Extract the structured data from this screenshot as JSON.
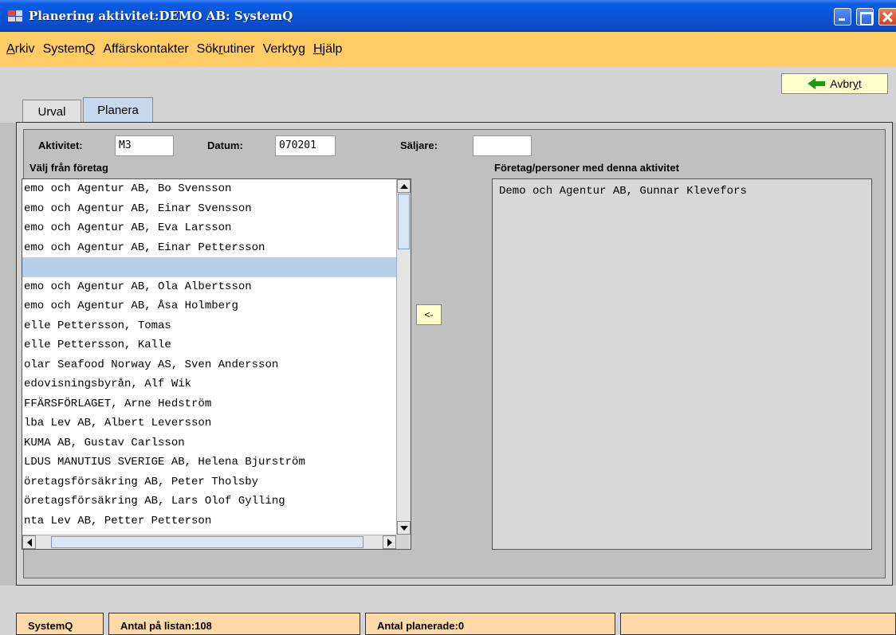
{
  "window": {
    "title": "Planering aktivitet:DEMO AB: SystemQ"
  },
  "menu": [
    {
      "pre": "",
      "ul": "A",
      "post": "rkiv"
    },
    {
      "pre": "System",
      "ul": "Q",
      "post": ""
    },
    {
      "pre": "Affärskontakter",
      "ul": "",
      "post": ""
    },
    {
      "pre": "Sök",
      "ul": "r",
      "post": "utiner"
    },
    {
      "pre": "Verktyg",
      "ul": "",
      "post": ""
    },
    {
      "pre": "",
      "ul": "H",
      "post": "jälp"
    }
  ],
  "toolbar": {
    "cancel_label_pre": "Avbr",
    "cancel_label_ul": "y",
    "cancel_label_post": "t"
  },
  "tabs": [
    {
      "label": "Urval",
      "active": false
    },
    {
      "label": "Planera",
      "active": true
    }
  ],
  "form": {
    "activity_label": "Aktivitet:",
    "activity_value": "M3",
    "date_label": "Datum:",
    "date_value": "070201",
    "seller_label": "Säljare:",
    "seller_value": ""
  },
  "left_list": {
    "title": "Välj från företag",
    "selected_index": 4,
    "items": [
      "emo och Agentur AB,  Bo Svensson",
      "emo och Agentur AB,  Einar Svensson",
      "emo och Agentur AB,  Eva Larsson",
      "emo och Agentur AB,  Einar Pettersson",
      "",
      "emo och Agentur AB,  Ola Albertsson",
      "emo och Agentur AB,  Åsa Holmberg",
      "elle Pettersson,  Tomas",
      "elle Pettersson,  Kalle",
      "olar Seafood Norway AS,  Sven Andersson",
      "edovisningsbyrån,  Alf Wik",
      "FFÄRSFÖRLAGET,  Arne Hedström",
      "lba Lev AB,  Albert Leversson",
      "KUMA AB,  Gustav Carlsson",
      "LDUS MANUTIUS SVERIGE AB,  Helena Bjurström",
      "öretagsförsäkring AB,  Peter Tholsby",
      "öretagsförsäkring AB,  Lars Olof Gylling",
      "nta Lev AB,  Petter Petterson"
    ]
  },
  "move_button_label": "<-",
  "right_list": {
    "title": "Företag/personer med denna aktivitet",
    "items": [
      "Demo och Agentur AB,  Gunnar Klevefors"
    ]
  },
  "status": {
    "app": "SystemQ",
    "count_on_list": "Antal på listan:108",
    "count_planned": "Antal planerade:0",
    "extra": ""
  },
  "colors": {
    "menubar": "#ffcc66",
    "statusbar": "#ffd9a8",
    "button": "#ffffcc",
    "selected_row": "#b8cfe8"
  }
}
